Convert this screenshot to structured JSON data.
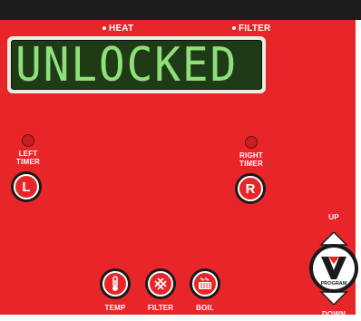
{
  "indicators": {
    "heat": "HEAT",
    "filter": "FILTER"
  },
  "display": {
    "text": "UNLOCKED"
  },
  "timers": {
    "left_label_line1": "LEFT",
    "left_label_line2": "TIMER",
    "left_button": "L",
    "right_label_line1": "RIGHT",
    "right_label_line2": "TIMER",
    "right_button": "R"
  },
  "functions": {
    "temp": "TEMP",
    "filter": "FILTER",
    "boil": "BOIL"
  },
  "program": {
    "up": "UP",
    "down": "DOWN",
    "logo_letter": "V",
    "label": "PROGRAM"
  },
  "colors": {
    "panel": "#e8262a",
    "lcd_background": "#1f3a16",
    "lcd_text": "#8fe07a"
  },
  "icons": {
    "temp": "thermometer-icon",
    "filter": "filter-mesh-icon",
    "boil": "boil-pot-icon"
  }
}
